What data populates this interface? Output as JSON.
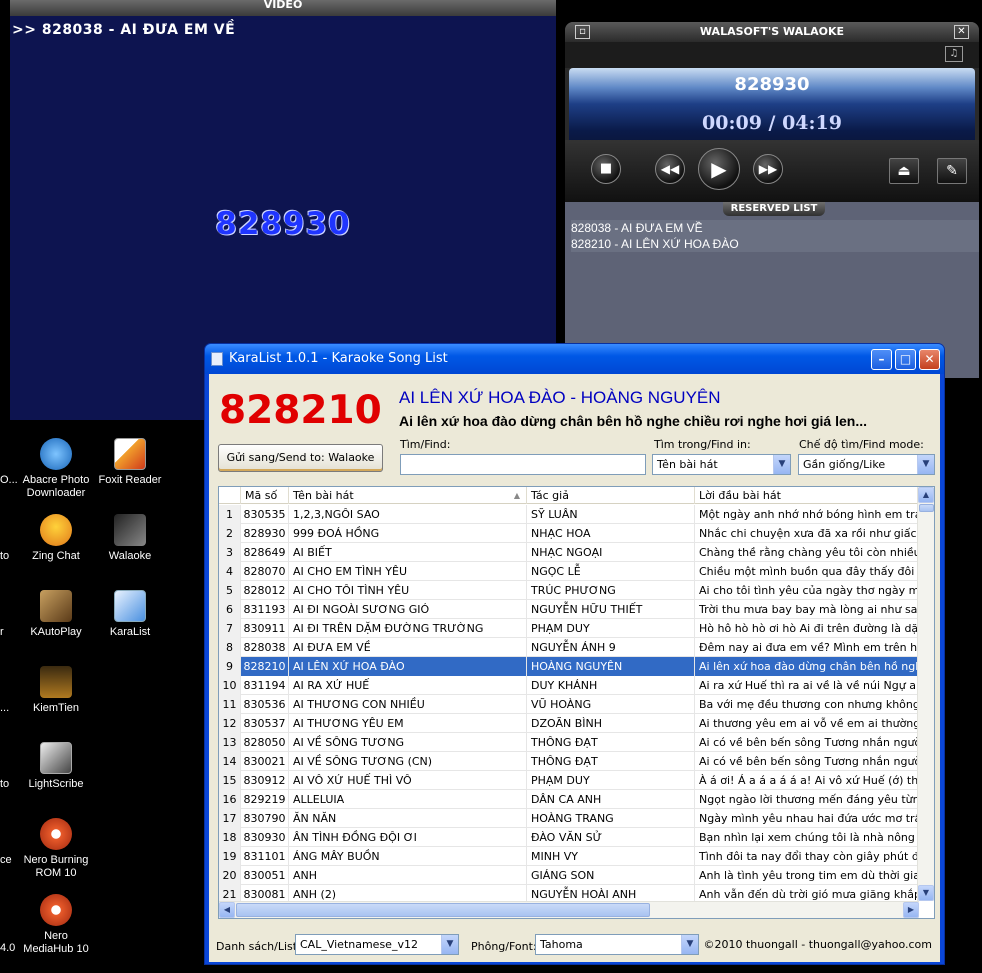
{
  "video": {
    "title": "VIDEO",
    "queue_text": ">> 828038 - AI ĐƯA EM VỀ",
    "current_code": "828930"
  },
  "desktop": {
    "icons": [
      {
        "label": "Abacre Photo Downloader",
        "icon": "abacre-icon"
      },
      {
        "label": "Foxit Reader",
        "icon": "foxit-icon"
      },
      {
        "label": "Zing Chat",
        "icon": "zing-chat-icon"
      },
      {
        "label": "Walaoke",
        "icon": "walaoke-icon"
      },
      {
        "label": "KAutoPlay",
        "icon": "kautoplay-icon"
      },
      {
        "label": "KaraList",
        "icon": "karalist-icon"
      },
      {
        "label": "KiemTien",
        "icon": "kiemtien-icon"
      },
      {
        "label": "LightScribe",
        "icon": "lightscribe-icon"
      },
      {
        "label": "Nero Burning ROM 10",
        "icon": "nero-icon"
      },
      {
        "label": "Nero MediaHub 10",
        "icon": "nero-mediahub-icon"
      }
    ],
    "edge_labels": [
      "O...",
      "to",
      "r",
      "...",
      "to",
      "ce",
      "4.0"
    ]
  },
  "player": {
    "title": "WALASOFT'S WALAOKE",
    "code": "828930",
    "time": "00:09 / 04:19",
    "reserved_label": "RESERVED LIST",
    "reserved": [
      "828038 - AI ĐƯA EM VỀ",
      "828210 - AI LÊN XỨ HOA ĐÀO"
    ]
  },
  "karalist": {
    "title": "KaraList 1.0.1 - Karaoke Song List",
    "current_code": "828210",
    "current_song": "AI LÊN XỨ HOA ĐÀO - HOÀNG NGUYÊN",
    "current_lyric": "Ai lên xứ hoa đào dừng chân bên hồ nghe chiều rơi nghe hơi giá len...",
    "send_button": "Gửi sang/Send to: Walaoke",
    "find_label": "Tìm/Find:",
    "find_value": "",
    "find_in_label": "Tìm trong/Find in:",
    "find_in_value": "Tên bài hát",
    "find_mode_label": "Chế độ tìm/Find mode:",
    "find_mode_value": "Gần giống/Like",
    "columns": [
      "Mã số",
      "Tên bài hát",
      "Tác giả",
      "Lời đầu bài hát"
    ],
    "selected_row": 9,
    "rows": [
      [
        "1",
        "830535",
        "1,2,3,NGÔI SAO",
        "SỸ LUÂN",
        "Một ngày anh nhớ nhớ bóng hình em trái tim m"
      ],
      [
        "2",
        "828930",
        "999 ĐOÁ HỒNG",
        "NHẠC HOA",
        "Nhắc chi chuyện xưa đã xa rồi như giấc mơ ch"
      ],
      [
        "3",
        "828649",
        "AI BIẾT",
        "NHẠC NGOẠI",
        "Chàng thề rằng chàng yêu tôi còn nhiều hơn t"
      ],
      [
        "4",
        "828070",
        "AI CHO EM TÌNH YÊU",
        "NGỌC LỄ",
        "Chiều một mình buồn qua đây thấy đôi lứa yêu"
      ],
      [
        "5",
        "828012",
        "AI CHO TÔI TÌNH YÊU",
        "TRÚC PHƯƠNG",
        "Ai cho tôi tình yêu của ngày thơ ngày mộng Tố"
      ],
      [
        "6",
        "831193",
        "AI ĐI NGOÀI SƯƠNG GIÓ",
        "NGUYỄN HỮU THIẾT",
        "Trời thu mưa bay bay mà lòng ai như say hoa"
      ],
      [
        "7",
        "830911",
        "AI ĐI TRÊN DẶM ĐƯỜNG TRƯỜNG",
        "PHẠM DUY",
        "Hò hô hò hò ơi hò Ai đi trên đường là dặm đườ"
      ],
      [
        "8",
        "828038",
        "AI ĐƯA EM VỀ",
        "NGUYỄN ÁNH 9",
        "Đêm nay ai đưa em về? Mình em trên hè phố v"
      ],
      [
        "9",
        "828210",
        "AI LÊN XỨ HOA ĐÀO",
        "HOÀNG NGUYÊN",
        "Ai lên xứ hoa đào dừng chân bên hồ nghe chiề"
      ],
      [
        "10",
        "831194",
        "AI RA XỨ HUẾ",
        "DUY KHÁNH",
        "Ai ra xứ Huế thì ra ai về là về núi Ngự ai về là"
      ],
      [
        "11",
        "830536",
        "AI THƯƠNG CON NHIỀU",
        "VŨ HOÀNG",
        "Ba với mẹ đều thương con nhưng không biết a"
      ],
      [
        "12",
        "830537",
        "AI THƯƠNG YÊU EM",
        "DZOÃN BÌNH",
        "Ai thương yêu em ai vỗ về em ai thường hay v"
      ],
      [
        "13",
        "828050",
        "AI VỀ SÔNG TƯƠNG",
        "THÔNG ĐẠT",
        "Ai có về bên bến sông Tương nhắn người duyê"
      ],
      [
        "14",
        "830021",
        "AI VỀ SÔNG TƯƠNG (CN)",
        "THÔNG ĐẠT",
        "Ai có về bên bến sông Tương nhắn người duyê"
      ],
      [
        "15",
        "830912",
        "AI VÔ XỨ HUẾ THÌ VÔ",
        "PHẠM DUY",
        "À á ơi! Á a á a á á a! Ai vô xứ Huế (ớ) thì vô C"
      ],
      [
        "16",
        "829219",
        "ALLELUIA",
        "DÂN CA ANH",
        "Ngọt ngào lời thương mến đáng yêu từng cơn"
      ],
      [
        "17",
        "830790",
        "ĂN NĂN",
        "HOÀNG TRANG",
        "Ngày mình yêu nhau hai đứa ước mơ trầu cau"
      ],
      [
        "18",
        "830930",
        "ÂN TÌNH ĐỒNG ĐỘI ƠI",
        "ĐÀO VĂN SỬ",
        "Bạn nhìn lại xem chúng tôi là nhà nông những"
      ],
      [
        "19",
        "831101",
        "ÁNG MÂY BUỒN",
        "MINH VY",
        "Tình đôi ta nay đổi thay còn giây phút để bờ n"
      ],
      [
        "20",
        "830051",
        "ANH",
        "GIÁNG SON",
        "Anh là tình yêu trong tim em dù thời gian có cả"
      ],
      [
        "21",
        "830081",
        "ANH (2)",
        "NGUYỄN HOÀI ANH",
        "Anh vẫn đến dù trời gió mưa giăng khắp lối dù"
      ]
    ],
    "list_label": "Danh sách/List:",
    "list_value": "CAL_Vietnamese_v12",
    "font_label": "Phông/Font:",
    "font_value": "Tahoma",
    "copyright": "©2010 thuongall - thuongall@yahoo.com"
  }
}
